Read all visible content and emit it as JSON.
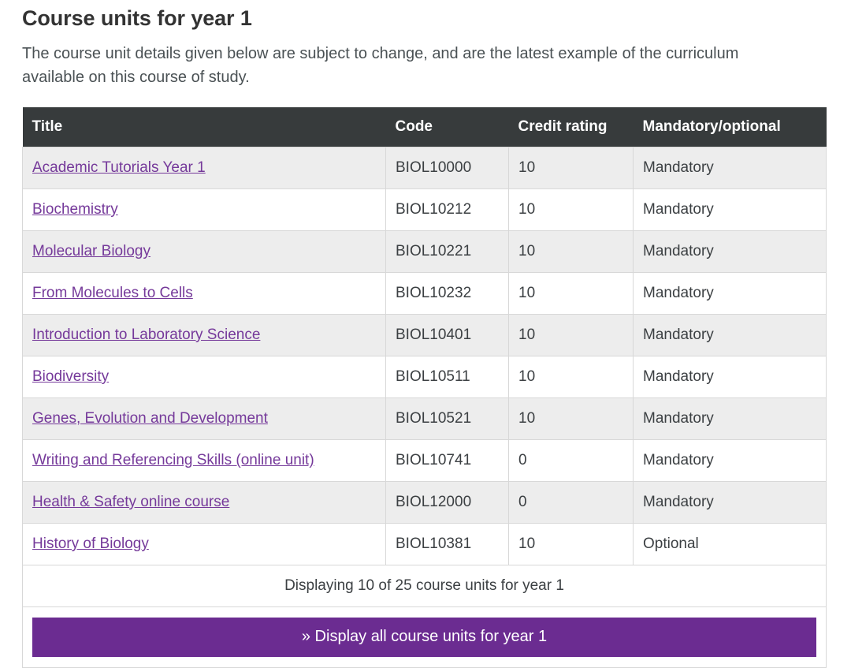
{
  "heading": "Course units for year 1",
  "intro": "The course unit details given below are subject to change, and are the latest example of the curriculum available on this course of study.",
  "table": {
    "columns": {
      "title": "Title",
      "code": "Code",
      "credit": "Credit rating",
      "mandatory": "Mandatory/optional"
    },
    "rows": [
      {
        "title": "Academic Tutorials Year 1",
        "code": "BIOL10000",
        "credit": "10",
        "mandatory": "Mandatory"
      },
      {
        "title": "Biochemistry",
        "code": "BIOL10212",
        "credit": "10",
        "mandatory": "Mandatory"
      },
      {
        "title": "Molecular Biology",
        "code": "BIOL10221",
        "credit": "10",
        "mandatory": "Mandatory"
      },
      {
        "title": "From Molecules to Cells",
        "code": "BIOL10232",
        "credit": "10",
        "mandatory": "Mandatory"
      },
      {
        "title": "Introduction to Laboratory Science",
        "code": "BIOL10401",
        "credit": "10",
        "mandatory": "Mandatory"
      },
      {
        "title": "Biodiversity",
        "code": "BIOL10511",
        "credit": "10",
        "mandatory": "Mandatory"
      },
      {
        "title": "Genes, Evolution and Development",
        "code": "BIOL10521",
        "credit": "10",
        "mandatory": "Mandatory"
      },
      {
        "title": "Writing and Referencing Skills (online unit)",
        "code": "BIOL10741",
        "credit": "0",
        "mandatory": "Mandatory"
      },
      {
        "title": "Health & Safety online course",
        "code": "BIOL12000",
        "credit": "0",
        "mandatory": "Mandatory"
      },
      {
        "title": "History of Biology",
        "code": "BIOL10381",
        "credit": "10",
        "mandatory": "Optional"
      }
    ],
    "summary": "Displaying 10 of 25 course units for year 1",
    "cta_label": "» Display all course units for year 1"
  },
  "colors": {
    "header_bg": "#373b3c",
    "cta_bg": "#6b2c91",
    "link": "#75399a",
    "row_alt_bg": "#ededed",
    "border": "#d8d8d8",
    "heading_text": "#333333",
    "body_text": "#4a5154"
  }
}
